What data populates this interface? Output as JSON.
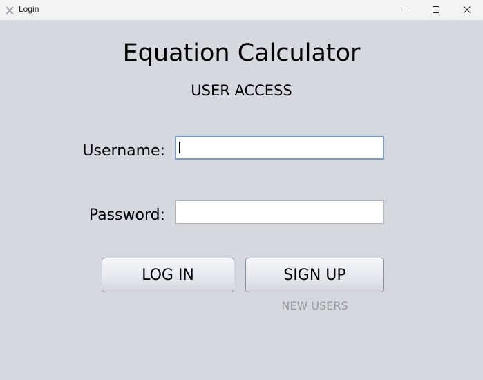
{
  "window": {
    "title": "Login",
    "icon": "app-logo-icon",
    "controls": [
      "minimize-icon",
      "maximize-icon",
      "close-icon"
    ]
  },
  "main": {
    "app_title": "Equation Calculator",
    "subtitle": "USER ACCESS",
    "username": {
      "label": "Username:",
      "value": "",
      "placeholder": ""
    },
    "password": {
      "label": "Password:",
      "value": "",
      "placeholder": ""
    },
    "login_label": "LOG IN",
    "signup_label": "SIGN UP",
    "new_users_note": "NEW USERS"
  },
  "colors": {
    "background": "#d6d8e0",
    "titlebar": "#f3f3f3",
    "focus_border": "#7a9cc8",
    "note_text": "#9a9a9a"
  }
}
